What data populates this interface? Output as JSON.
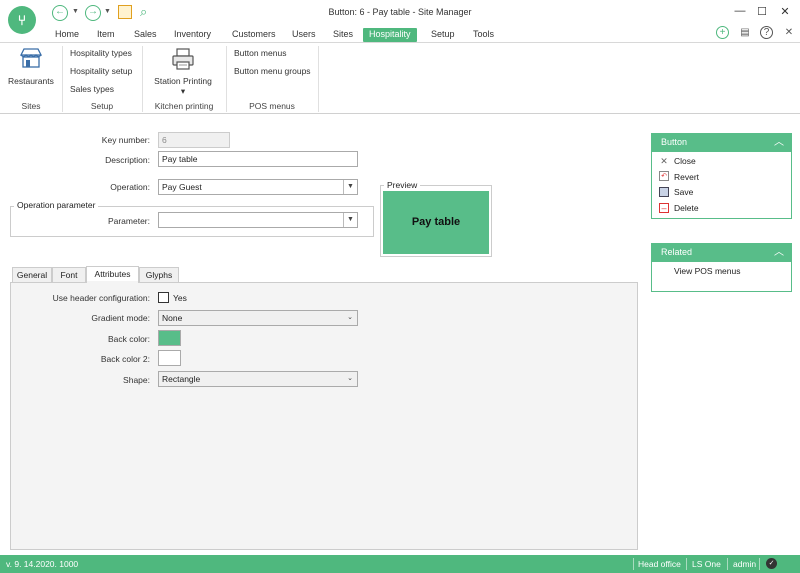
{
  "window": {
    "title": "Button: 6 - Pay table - Site Manager"
  },
  "menu": {
    "tabs": [
      "Home",
      "Item",
      "Sales",
      "Inventory",
      "Customers",
      "Users",
      "Sites",
      "Hospitality",
      "Setup",
      "Tools"
    ],
    "active_tab": "Hospitality"
  },
  "ribbon": {
    "restaurants_label": "Restaurants",
    "sites_group": "Sites",
    "hospitality_types": "Hospitality types",
    "hospitality_setup": "Hospitality setup",
    "sales_types": "Sales types",
    "setup_group": "Setup",
    "station_printing": "Station Printing",
    "kitchen_printing_group": "Kitchen printing",
    "button_menus": "Button menus",
    "button_menu_groups": "Button menu groups",
    "pos_menus_group": "POS menus"
  },
  "form": {
    "key_number_label": "Key number:",
    "key_number_value": "6",
    "description_label": "Description:",
    "description_value": "Pay table",
    "operation_label": "Operation:",
    "operation_value": "Pay Guest",
    "operation_parameter_group": "Operation parameter",
    "parameter_label": "Parameter:",
    "parameter_value": "",
    "preview_label": "Preview",
    "preview_button_text": "Pay table",
    "preview_color": "#58bd89"
  },
  "subtabs": [
    "General",
    "Font",
    "Attributes",
    "Glyphs"
  ],
  "active_subtab": "Attributes",
  "attributes": {
    "use_header_label": "Use header configuration:",
    "use_header_checkbox_label": "Yes",
    "use_header_checked": false,
    "gradient_mode_label": "Gradient mode:",
    "gradient_mode_value": "None",
    "back_color_label": "Back color:",
    "back_color": "#58bd89",
    "back_color_2_label": "Back color 2:",
    "back_color_2": "#ffffff",
    "shape_label": "Shape:",
    "shape_value": "Rectangle"
  },
  "button_panel": {
    "title": "Button",
    "actions": [
      "Close",
      "Revert",
      "Save",
      "Delete"
    ]
  },
  "related_panel": {
    "title": "Related",
    "links": [
      "View POS menus"
    ]
  },
  "status_bar": {
    "version": "v. 9. 14.2020. 1000",
    "location": "Head office",
    "product": "LS One",
    "user": "admin"
  }
}
